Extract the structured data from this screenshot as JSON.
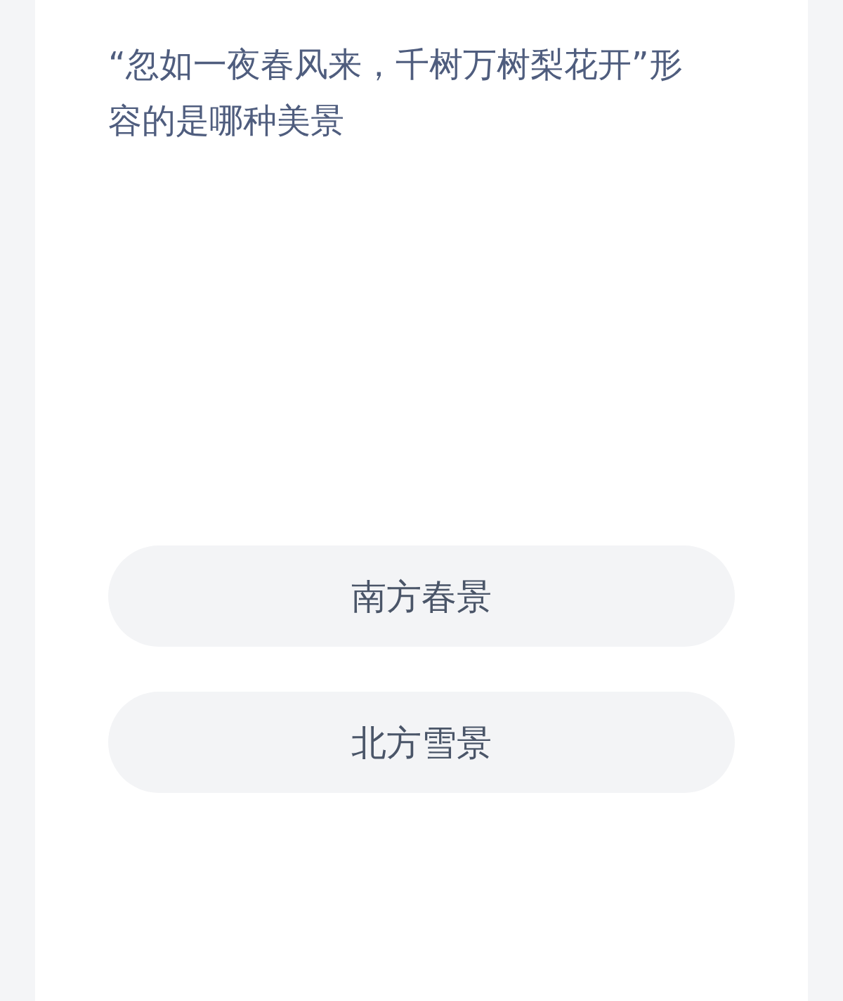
{
  "question": "“忽如一夜春风来，千树万树梨花开”形容的是哪种美景",
  "options": [
    {
      "label": "南方春景"
    },
    {
      "label": "北方雪景"
    }
  ]
}
